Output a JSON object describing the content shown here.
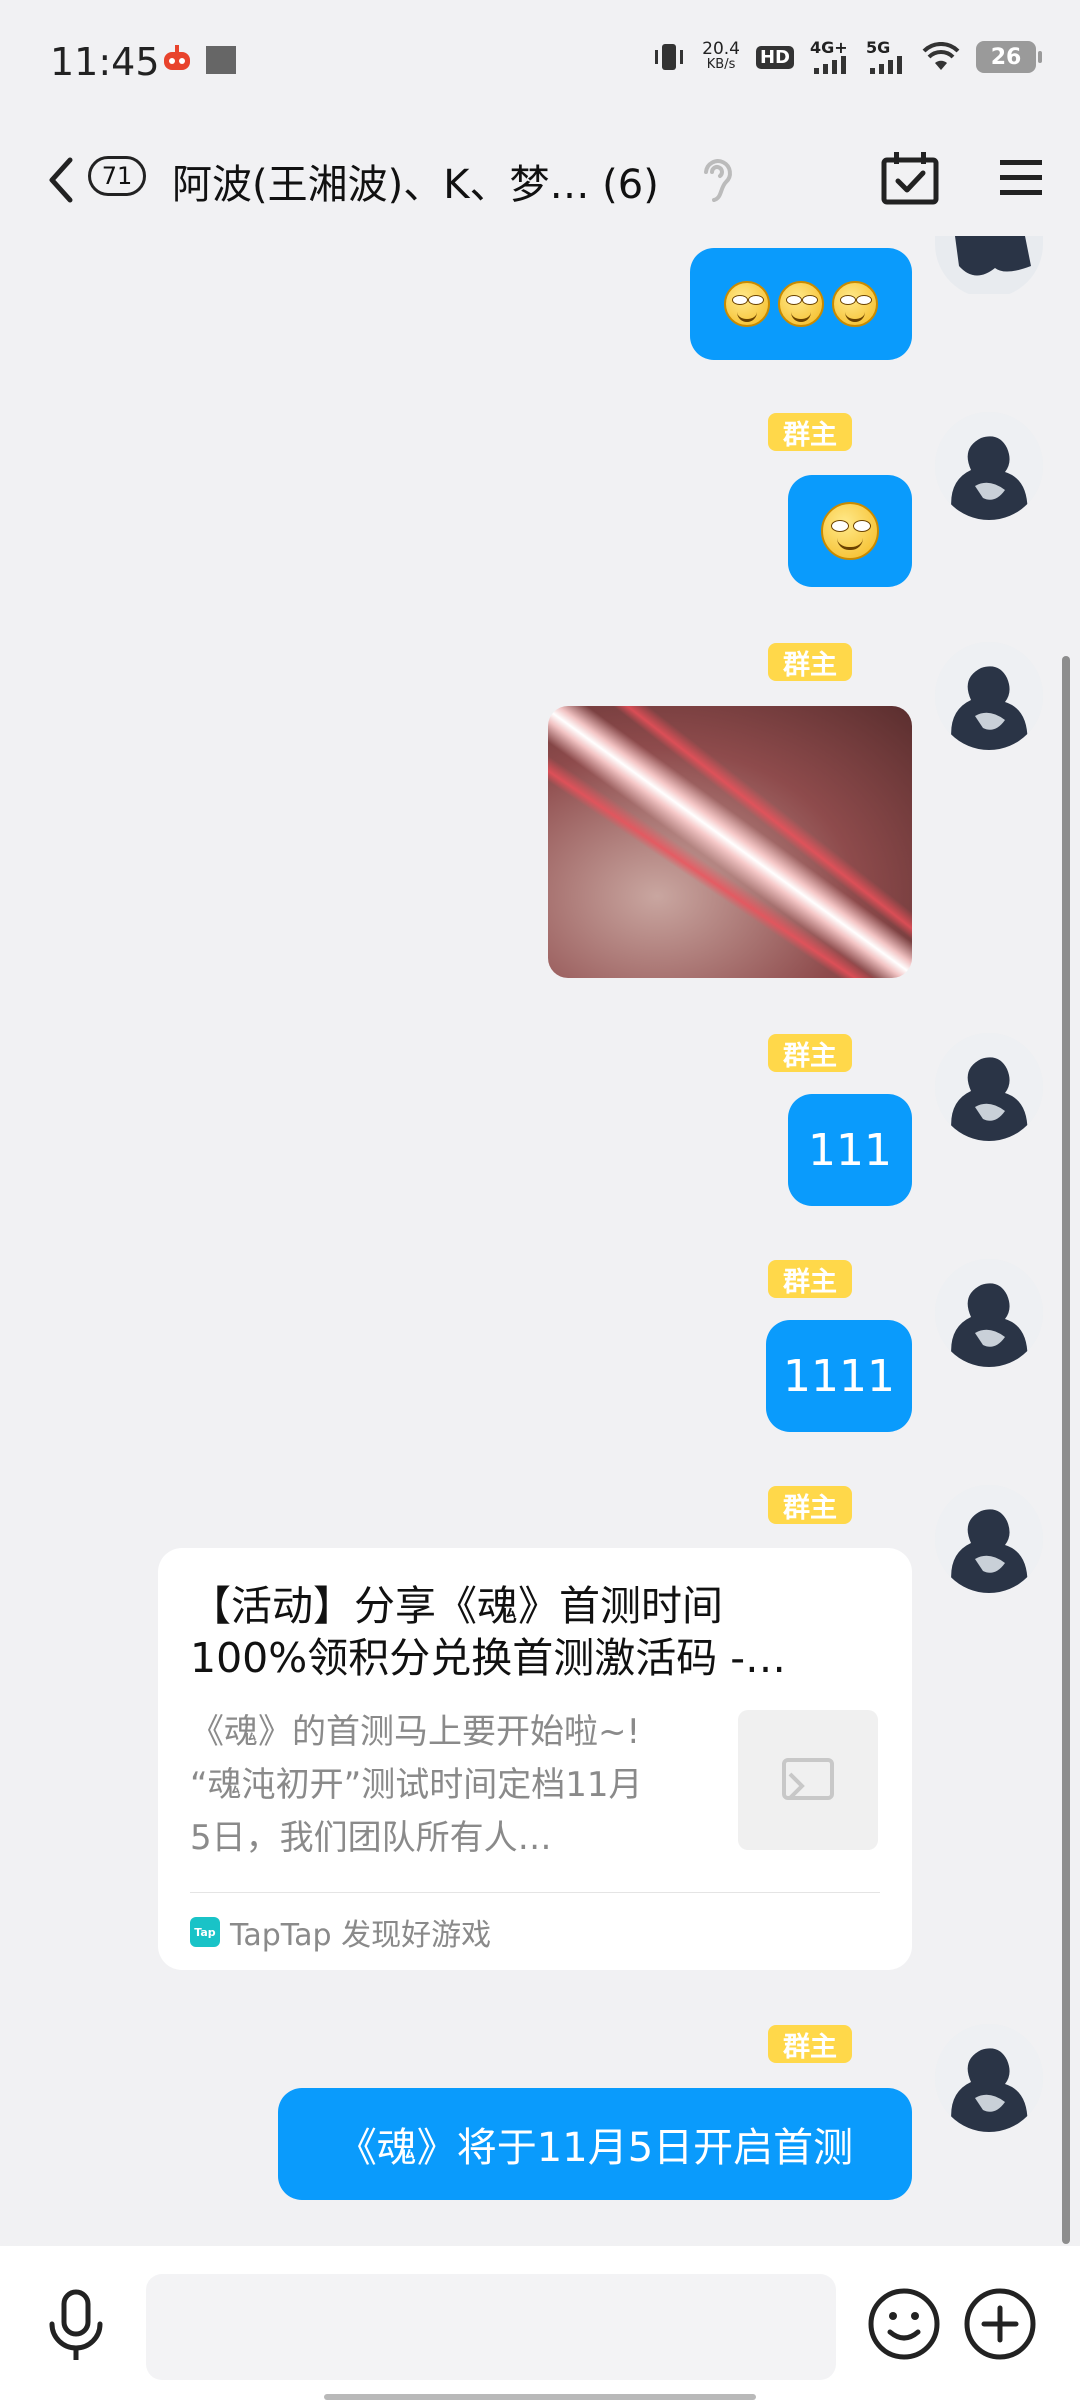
{
  "status_bar": {
    "time": "11:45",
    "speed_value": "20.4",
    "speed_unit": "KB/s",
    "hd_label": "HD",
    "sim1_label": "4G+",
    "sim2_label": "5G",
    "battery": "26"
  },
  "header": {
    "unread_count": "71",
    "title": "阿波(王湘波)、K、梦… (6)"
  },
  "messages": {
    "m1": {
      "type": "emoji",
      "count": 3
    },
    "m2": {
      "badge": "群主",
      "type": "emoji",
      "count": 1
    },
    "m3": {
      "badge": "群主",
      "type": "image"
    },
    "m4": {
      "badge": "群主",
      "text": "111"
    },
    "m5": {
      "badge": "群主",
      "text": "1111"
    },
    "m6": {
      "badge": "群主",
      "card_title_line1": "【活动】分享《魂》首测时间",
      "card_title_line2": "100%领积分兑换首测激活码 -…",
      "card_desc_line1": "《魂》的首测马上要开始啦~!",
      "card_desc_line2": "“魂沌初开”测试时间定档11月",
      "card_desc_line3": "5日，我们团队所有人…",
      "source_logo": "Tap",
      "source": "TapTap 发现好游戏"
    },
    "m7": {
      "badge": "群主",
      "text": "《魂》将于11月5日开启首测"
    }
  },
  "input": {
    "placeholder": ""
  },
  "colors": {
    "bubble": "#0a9bfc",
    "badge": "#ffd84a",
    "background": "#f1f1f3"
  }
}
